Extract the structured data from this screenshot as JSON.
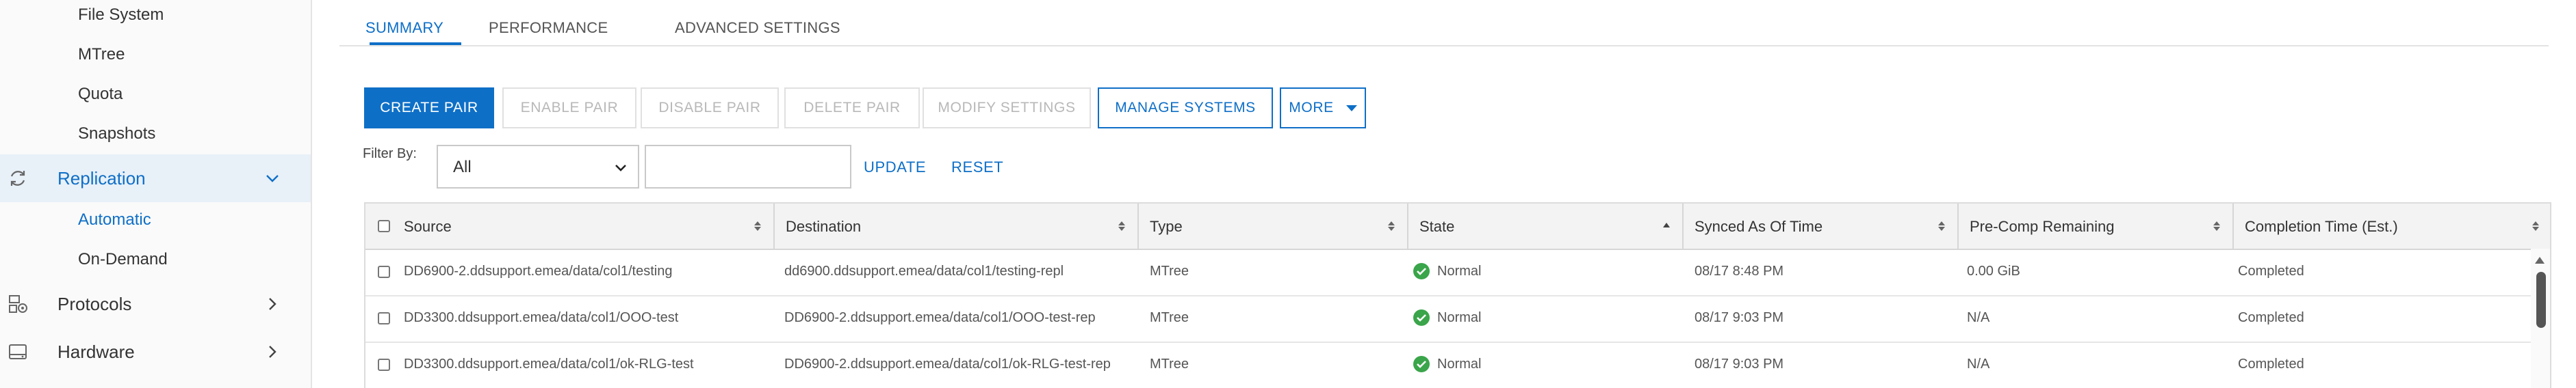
{
  "sidebar": {
    "sub_items_top": [
      "File System",
      "MTree",
      "Quota",
      "Snapshots"
    ],
    "replication": {
      "label": "Replication",
      "icon": "sync-icon"
    },
    "replication_sub": [
      "Automatic",
      "On-Demand"
    ],
    "protocols": {
      "label": "Protocols",
      "icon": "protocols-icon"
    },
    "hardware": {
      "label": "Hardware",
      "icon": "hardware-icon"
    }
  },
  "tabs": [
    "SUMMARY",
    "PERFORMANCE",
    "ADVANCED SETTINGS"
  ],
  "active_tab": "SUMMARY",
  "toolbar": {
    "create_pair": "CREATE PAIR",
    "enable_pair": "ENABLE PAIR",
    "disable_pair": "DISABLE PAIR",
    "delete_pair": "DELETE PAIR",
    "modify_settings": "MODIFY SETTINGS",
    "manage_systems": "MANAGE SYSTEMS",
    "more": "MORE"
  },
  "filter": {
    "label": "Filter By:",
    "selected": "All",
    "input_value": "",
    "update": "UPDATE",
    "reset": "RESET"
  },
  "table": {
    "columns": [
      "Source",
      "Destination",
      "Type",
      "State",
      "Synced As Of Time",
      "Pre-Comp Remaining",
      "Completion Time (Est.)"
    ],
    "rows": [
      {
        "source": "DD6900-2.ddsupport.emea/data/col1/testing",
        "destination": "dd6900.ddsupport.emea/data/col1/testing-repl",
        "type": "MTree",
        "state": "Normal",
        "synced": "08/17 8:48 PM",
        "precomp": "0.00 GiB",
        "completion": "Completed"
      },
      {
        "source": "DD3300.ddsupport.emea/data/col1/OOO-test",
        "destination": "DD6900-2.ddsupport.emea/data/col1/OOO-test-rep",
        "type": "MTree",
        "state": "Normal",
        "synced": "08/17 9:03 PM",
        "precomp": "N/A",
        "completion": "Completed"
      },
      {
        "source": "DD3300.ddsupport.emea/data/col1/ok-RLG-test",
        "destination": "DD6900-2.ddsupport.emea/data/col1/ok-RLG-test-rep",
        "type": "MTree",
        "state": "Normal",
        "synced": "08/17 9:03 PM",
        "precomp": "N/A",
        "completion": "Completed"
      }
    ]
  },
  "colors": {
    "accent": "#0e6fc7",
    "status_ok": "#3aa54a",
    "active_bg": "#e8f0f8"
  }
}
